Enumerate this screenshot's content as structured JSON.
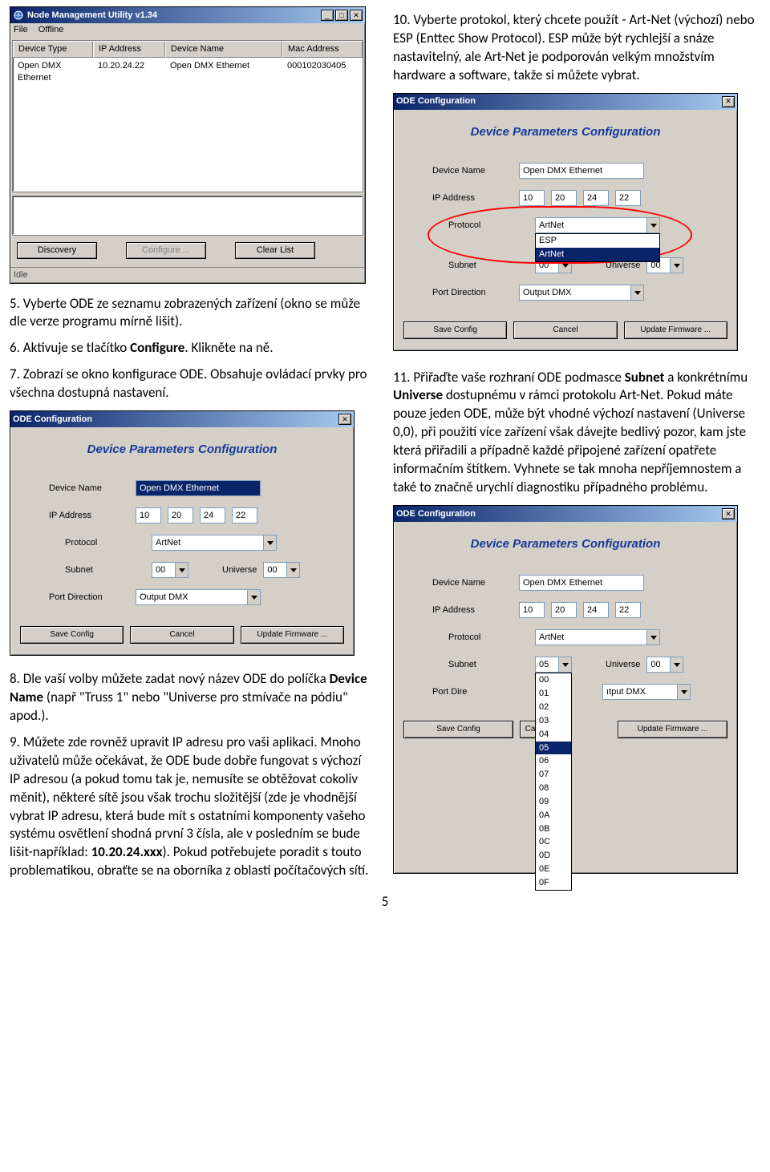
{
  "nmu": {
    "title": "Node Management Utility v1.34",
    "menu": {
      "file": "File",
      "offline": "Offline"
    },
    "columns": {
      "deviceType": "Device Type",
      "ip": "IP Address",
      "deviceName": "Device Name",
      "mac": "Mac Address"
    },
    "row": {
      "deviceType": "Open DMX Ethernet",
      "ip": "10.20.24.22",
      "deviceName": "Open DMX Ethernet",
      "mac": "000102030405"
    },
    "buttons": {
      "discovery": "Discovery",
      "configure": "Configure ...",
      "clear": "Clear List"
    },
    "status": "Idle"
  },
  "steps": {
    "s5": "5. Vyberte ODE ze seznamu zobrazených zařízení (okno se může dle verze programu mírně lišit).",
    "s6": "6. Aktivuje se tlačítko ",
    "s6b": "Configure",
    "s6c": ". Klikněte na ně.",
    "s7": "7. Zobrazí se okno konfigurace ODE. Obsahuje ovládací prvky pro všechna dostupná nastavení.",
    "s8a": "8. Dle vaší volby můžete zadat nový název ODE do políčka ",
    "s8b": "Device Name",
    "s8c": " (např \"Truss 1\" nebo \"Universe pro stmívače na pódiu\" apod.).",
    "s9": "9. Můžete zde rovněž upravit IP adresu pro vaši aplikaci. Mnoho uživatelů může očekávat, že ODE bude dobře fungovat s výchozí IP adresou (a pokud tomu tak je, nemusíte se obtěžovat cokoliv měnit), některé sítě jsou však trochu složitější (zde je vhodnější vybrat IP adresu, která bude mít s ostatními komponenty vašeho systému osvětlení shodná první 3 čísla, ale v posledním se bude lišit-například: ",
    "s9b": "10.20.24.xxx",
    "s9c": "). Pokud potřebujete poradit s touto problematikou, obraťte se na oborníka z oblasti počítačových sítí.",
    "s10": "10. Vyberte protokol, který chcete použít - Art‑Net (výchozí) nebo ESP (Enttec Show Protocol). ESP může být rychlejší a snáze nastavitelný, ale Art-Net je podporován velkým množstvím hardware a software, takže si můžete vybrat.",
    "s11a": "11. Přiřaďte vaše rozhraní ODE podmasce ",
    "s11b": "Subnet",
    "s11c": " a konkrétnímu ",
    "s11d": "Universe",
    "s11e": " dostupnému v rámci protokolu Art-Net. Pokud máte pouze jeden ODE, může být vhodné výchozí nastavení (Universe 0,0), při použití více zařízení však dávejte bedlivý pozor, kam jste která přiřadili a případně každé připojené zařízení opatřete informačním štítkem. Vyhnete se tak mnoha nepříjemnostem a také to značně urychlí diagnostiku případného problému."
  },
  "ode": {
    "title": "ODE Configuration",
    "heading": "Device Parameters Configuration",
    "labels": {
      "deviceName": "Device Name",
      "ip": "IP Address",
      "protocol": "Protocol",
      "subnet": "Subnet",
      "universe": "Universe",
      "portDirection": "Port Direction",
      "portDireShort": "Port Dire"
    },
    "values": {
      "deviceName": "Open DMX Ethernet",
      "ip1": "10",
      "ip2": "20",
      "ip3": "24",
      "ip4": "22",
      "protocol": "ArtNet",
      "subnet": "00",
      "universe": "00",
      "portDirection": "Output DMX",
      "portDirectionShort": "ıtput DMX"
    },
    "protoOptions": {
      "esp": "ESP",
      "artnet": "ArtNet"
    },
    "subnetOpen": {
      "sel": "05",
      "opts": [
        "00",
        "01",
        "02",
        "03",
        "04",
        "05",
        "06",
        "07",
        "08",
        "09",
        "0A",
        "0B",
        "0C",
        "0D",
        "0E",
        "0F"
      ]
    },
    "buttons": {
      "save": "Save Config",
      "cancel": "Cancel",
      "cancelShort": "Ca",
      "update": "Update Firmware ..."
    }
  },
  "icons": {
    "globe": "🌐"
  },
  "page": "5"
}
